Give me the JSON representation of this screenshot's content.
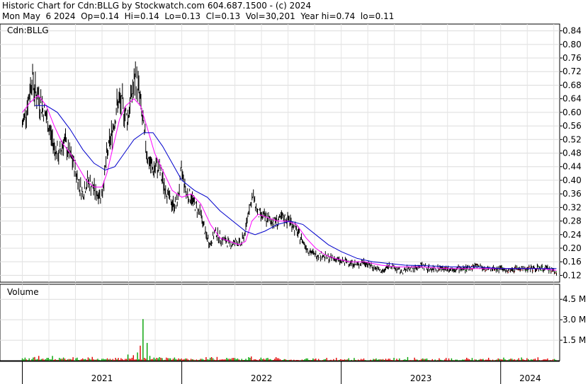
{
  "header": {
    "line1": "Historic Chart for Cdn:BLLG by Stockwatch.com 604.687.1500 - (c) 2024",
    "line2": "Mon May  6 2024  Op=0.14  Hi=0.14  Lo=0.13  Cl=0.13  Vol=30,201  Year hi=0.74  lo=0.11"
  },
  "chart_data": [
    {
      "type": "candlestick",
      "title": "Cdn:BLLG",
      "ylim": [
        0.1,
        0.86
      ],
      "y_ticks": [
        "0.84",
        "0.80",
        "0.76",
        "0.72",
        "0.68",
        "0.64",
        "0.60",
        "0.56",
        "0.52",
        "0.48",
        "0.44",
        "0.40",
        "0.36",
        "0.32",
        "0.28",
        "0.24",
        "0.20",
        "0.16",
        "0.12"
      ],
      "grid": true,
      "price_path": [
        [
          2021.0,
          0.56
        ],
        [
          2021.02,
          0.6
        ],
        [
          2021.04,
          0.64
        ],
        [
          2021.06,
          0.71
        ],
        [
          2021.08,
          0.66
        ],
        [
          2021.1,
          0.65
        ],
        [
          2021.12,
          0.62
        ],
        [
          2021.14,
          0.6
        ],
        [
          2021.17,
          0.55
        ],
        [
          2021.2,
          0.5
        ],
        [
          2021.23,
          0.47
        ],
        [
          2021.26,
          0.52
        ],
        [
          2021.29,
          0.48
        ],
        [
          2021.32,
          0.45
        ],
        [
          2021.35,
          0.4
        ],
        [
          2021.38,
          0.36
        ],
        [
          2021.41,
          0.4
        ],
        [
          2021.44,
          0.38
        ],
        [
          2021.47,
          0.36
        ],
        [
          2021.5,
          0.36
        ],
        [
          2021.53,
          0.47
        ],
        [
          2021.57,
          0.56
        ],
        [
          2021.6,
          0.63
        ],
        [
          2021.63,
          0.62
        ],
        [
          2021.66,
          0.58
        ],
        [
          2021.68,
          0.64
        ],
        [
          2021.71,
          0.7
        ],
        [
          2021.73,
          0.67
        ],
        [
          2021.76,
          0.55
        ],
        [
          2021.79,
          0.46
        ],
        [
          2021.82,
          0.43
        ],
        [
          2021.85,
          0.44
        ],
        [
          2021.88,
          0.4
        ],
        [
          2021.91,
          0.36
        ],
        [
          2021.94,
          0.33
        ],
        [
          2021.97,
          0.33
        ],
        [
          2022.0,
          0.43
        ],
        [
          2022.03,
          0.36
        ],
        [
          2022.06,
          0.35
        ],
        [
          2022.09,
          0.32
        ],
        [
          2022.12,
          0.3
        ],
        [
          2022.15,
          0.24
        ],
        [
          2022.18,
          0.21
        ],
        [
          2022.21,
          0.25
        ],
        [
          2022.24,
          0.23
        ],
        [
          2022.28,
          0.22
        ],
        [
          2022.31,
          0.21
        ],
        [
          2022.34,
          0.22
        ],
        [
          2022.37,
          0.21
        ],
        [
          2022.4,
          0.25
        ],
        [
          2022.42,
          0.32
        ],
        [
          2022.45,
          0.35
        ],
        [
          2022.48,
          0.3
        ],
        [
          2022.52,
          0.29
        ],
        [
          2022.56,
          0.28
        ],
        [
          2022.6,
          0.28
        ],
        [
          2022.64,
          0.29
        ],
        [
          2022.68,
          0.28
        ],
        [
          2022.72,
          0.25
        ],
        [
          2022.76,
          0.22
        ],
        [
          2022.8,
          0.19
        ],
        [
          2022.84,
          0.18
        ],
        [
          2022.88,
          0.18
        ],
        [
          2022.92,
          0.17
        ],
        [
          2022.96,
          0.17
        ],
        [
          2023.0,
          0.16
        ],
        [
          2023.05,
          0.16
        ],
        [
          2023.1,
          0.15
        ],
        [
          2023.14,
          0.16
        ],
        [
          2023.18,
          0.15
        ],
        [
          2023.22,
          0.14
        ],
        [
          2023.26,
          0.13
        ],
        [
          2023.3,
          0.15
        ],
        [
          2023.34,
          0.14
        ],
        [
          2023.38,
          0.13
        ],
        [
          2023.42,
          0.14
        ],
        [
          2023.46,
          0.14
        ],
        [
          2023.5,
          0.15
        ],
        [
          2023.55,
          0.14
        ],
        [
          2023.6,
          0.14
        ],
        [
          2023.65,
          0.14
        ],
        [
          2023.7,
          0.14
        ],
        [
          2023.75,
          0.14
        ],
        [
          2023.8,
          0.14
        ],
        [
          2023.85,
          0.15
        ],
        [
          2023.9,
          0.14
        ],
        [
          2023.95,
          0.14
        ],
        [
          2024.0,
          0.14
        ],
        [
          2024.05,
          0.13
        ],
        [
          2024.1,
          0.14
        ],
        [
          2024.15,
          0.14
        ],
        [
          2024.2,
          0.14
        ],
        [
          2024.25,
          0.14
        ],
        [
          2024.3,
          0.14
        ],
        [
          2024.35,
          0.13
        ]
      ],
      "series": [
        {
          "name": "",
          "color": "#ff00ff",
          "values": [
            [
              2021.0,
              0.6
            ],
            [
              2021.05,
              0.63
            ],
            [
              2021.1,
              0.65
            ],
            [
              2021.15,
              0.62
            ],
            [
              2021.2,
              0.56
            ],
            [
              2021.25,
              0.51
            ],
            [
              2021.3,
              0.48
            ],
            [
              2021.35,
              0.44
            ],
            [
              2021.4,
              0.4
            ],
            [
              2021.45,
              0.38
            ],
            [
              2021.5,
              0.38
            ],
            [
              2021.53,
              0.42
            ],
            [
              2021.57,
              0.5
            ],
            [
              2021.61,
              0.58
            ],
            [
              2021.65,
              0.62
            ],
            [
              2021.7,
              0.64
            ],
            [
              2021.74,
              0.62
            ],
            [
              2021.78,
              0.56
            ],
            [
              2021.83,
              0.48
            ],
            [
              2021.88,
              0.43
            ],
            [
              2021.94,
              0.37
            ],
            [
              2022.0,
              0.35
            ],
            [
              2022.06,
              0.36
            ],
            [
              2022.12,
              0.33
            ],
            [
              2022.18,
              0.27
            ],
            [
              2022.24,
              0.23
            ],
            [
              2022.3,
              0.22
            ],
            [
              2022.36,
              0.21
            ],
            [
              2022.4,
              0.22
            ],
            [
              2022.44,
              0.28
            ],
            [
              2022.48,
              0.3
            ],
            [
              2022.54,
              0.29
            ],
            [
              2022.6,
              0.28
            ],
            [
              2022.66,
              0.28
            ],
            [
              2022.72,
              0.27
            ],
            [
              2022.78,
              0.23
            ],
            [
              2022.84,
              0.2
            ],
            [
              2022.9,
              0.18
            ],
            [
              2022.96,
              0.17
            ],
            [
              2023.05,
              0.16
            ],
            [
              2023.15,
              0.16
            ],
            [
              2023.25,
              0.15
            ],
            [
              2023.35,
              0.145
            ],
            [
              2023.5,
              0.145
            ],
            [
              2023.65,
              0.14
            ],
            [
              2023.8,
              0.14
            ],
            [
              2023.95,
              0.14
            ],
            [
              2024.1,
              0.14
            ],
            [
              2024.25,
              0.14
            ],
            [
              2024.35,
              0.135
            ]
          ]
        },
        {
          "name": "",
          "color": "#0000cc",
          "values": [
            [
              2021.08,
              0.62
            ],
            [
              2021.15,
              0.62
            ],
            [
              2021.22,
              0.6
            ],
            [
              2021.3,
              0.55
            ],
            [
              2021.38,
              0.49
            ],
            [
              2021.45,
              0.45
            ],
            [
              2021.52,
              0.43
            ],
            [
              2021.58,
              0.44
            ],
            [
              2021.64,
              0.48
            ],
            [
              2021.7,
              0.52
            ],
            [
              2021.76,
              0.54
            ],
            [
              2021.82,
              0.54
            ],
            [
              2021.88,
              0.5
            ],
            [
              2021.94,
              0.45
            ],
            [
              2022.0,
              0.4
            ],
            [
              2022.08,
              0.37
            ],
            [
              2022.16,
              0.35
            ],
            [
              2022.24,
              0.31
            ],
            [
              2022.32,
              0.28
            ],
            [
              2022.4,
              0.25
            ],
            [
              2022.46,
              0.24
            ],
            [
              2022.52,
              0.25
            ],
            [
              2022.6,
              0.27
            ],
            [
              2022.68,
              0.28
            ],
            [
              2022.76,
              0.27
            ],
            [
              2022.84,
              0.24
            ],
            [
              2022.92,
              0.21
            ],
            [
              2023.0,
              0.19
            ],
            [
              2023.1,
              0.17
            ],
            [
              2023.2,
              0.16
            ],
            [
              2023.3,
              0.155
            ],
            [
              2023.4,
              0.15
            ],
            [
              2023.55,
              0.148
            ],
            [
              2023.7,
              0.145
            ],
            [
              2023.85,
              0.145
            ],
            [
              2024.0,
              0.14
            ],
            [
              2024.15,
              0.14
            ],
            [
              2024.3,
              0.14
            ],
            [
              2024.35,
              0.14
            ]
          ]
        }
      ]
    },
    {
      "type": "bar",
      "title": "Volume",
      "y_ticks": [
        "4.5 M",
        "3.0 M",
        "1.5 M"
      ],
      "ylim": [
        0,
        5.6
      ],
      "volume_spikes": [
        [
          2021.1,
          0.35
        ],
        [
          2021.3,
          0.12
        ],
        [
          2021.6,
          0.2
        ],
        [
          2021.66,
          0.45
        ],
        [
          2021.7,
          0.4
        ],
        [
          2021.72,
          0.6
        ],
        [
          2021.74,
          1.1
        ],
        [
          2021.76,
          3.05
        ],
        [
          2021.78,
          1.3
        ],
        [
          2021.8,
          0.35
        ],
        [
          2021.95,
          0.12
        ],
        [
          2022.42,
          0.18
        ],
        [
          2022.45,
          0.1
        ]
      ]
    }
  ],
  "x_axis": {
    "labels": [
      {
        "year": 2021,
        "text": "2021"
      },
      {
        "year": 2022,
        "text": "2022"
      },
      {
        "year": 2023,
        "text": "2023"
      },
      {
        "year": 2024,
        "text": "2024"
      }
    ]
  }
}
